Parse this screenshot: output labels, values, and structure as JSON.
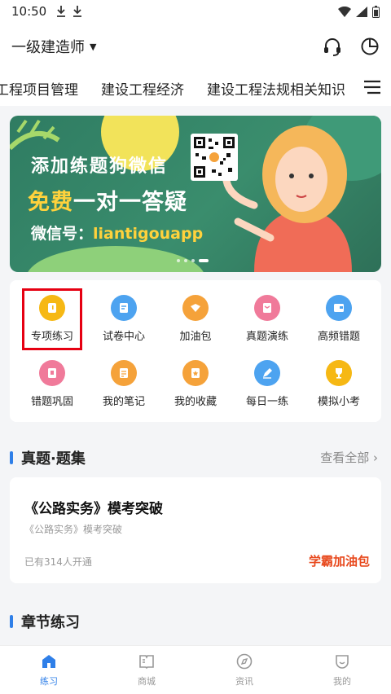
{
  "status_bar": {
    "time": "10:50"
  },
  "header": {
    "exam_name": "一级建造师"
  },
  "subject_tabs": [
    "工程项目管理",
    "建设工程经济",
    "建设工程法规相关知识"
  ],
  "banner": {
    "line1": "添加练题狗微信",
    "line2_highlight": "免费",
    "line2_rest": "一对一答疑",
    "line3_label": "微信号：",
    "line3_value": "liantigouapp"
  },
  "functions": [
    {
      "label": "专项练习",
      "icon": "special-practice-icon",
      "color": "#f6b814"
    },
    {
      "label": "试卷中心",
      "icon": "paper-center-icon",
      "color": "#4da3f0"
    },
    {
      "label": "加油包",
      "icon": "fuel-pack-icon",
      "color": "#f5a23a"
    },
    {
      "label": "真题演练",
      "icon": "real-exam-icon",
      "color": "#f07a9a"
    },
    {
      "label": "高频错题",
      "icon": "frequent-errors-icon",
      "color": "#4da3f0"
    },
    {
      "label": "错题巩固",
      "icon": "error-review-icon",
      "color": "#f07a9a"
    },
    {
      "label": "我的笔记",
      "icon": "notes-icon",
      "color": "#f5a23a"
    },
    {
      "label": "我的收藏",
      "icon": "favorites-icon",
      "color": "#f5a23a"
    },
    {
      "label": "每日一练",
      "icon": "daily-practice-icon",
      "color": "#4da3f0"
    },
    {
      "label": "模拟小考",
      "icon": "mock-exam-icon",
      "color": "#f6b814"
    }
  ],
  "section_exam": {
    "title": "真题·题集",
    "see_all": "查看全部 ›"
  },
  "paper_card": {
    "title": "《公路实务》模考突破",
    "subtitle": "《公路实务》模考突破",
    "count": "已有314人开通",
    "tag": "学霸加油包"
  },
  "section_chapter": {
    "title": "章节练习"
  },
  "bottom_nav": [
    {
      "label": "练习",
      "icon": "home-icon",
      "active": true
    },
    {
      "label": "商城",
      "icon": "book-icon",
      "active": false
    },
    {
      "label": "资讯",
      "icon": "compass-icon",
      "active": false
    },
    {
      "label": "我的",
      "icon": "profile-icon",
      "active": false
    }
  ],
  "colors": {
    "primary": "#2f7fe8",
    "accent": "#e8491d",
    "banner_bg": "#2f7c62",
    "highlight": "#ffd23c"
  }
}
